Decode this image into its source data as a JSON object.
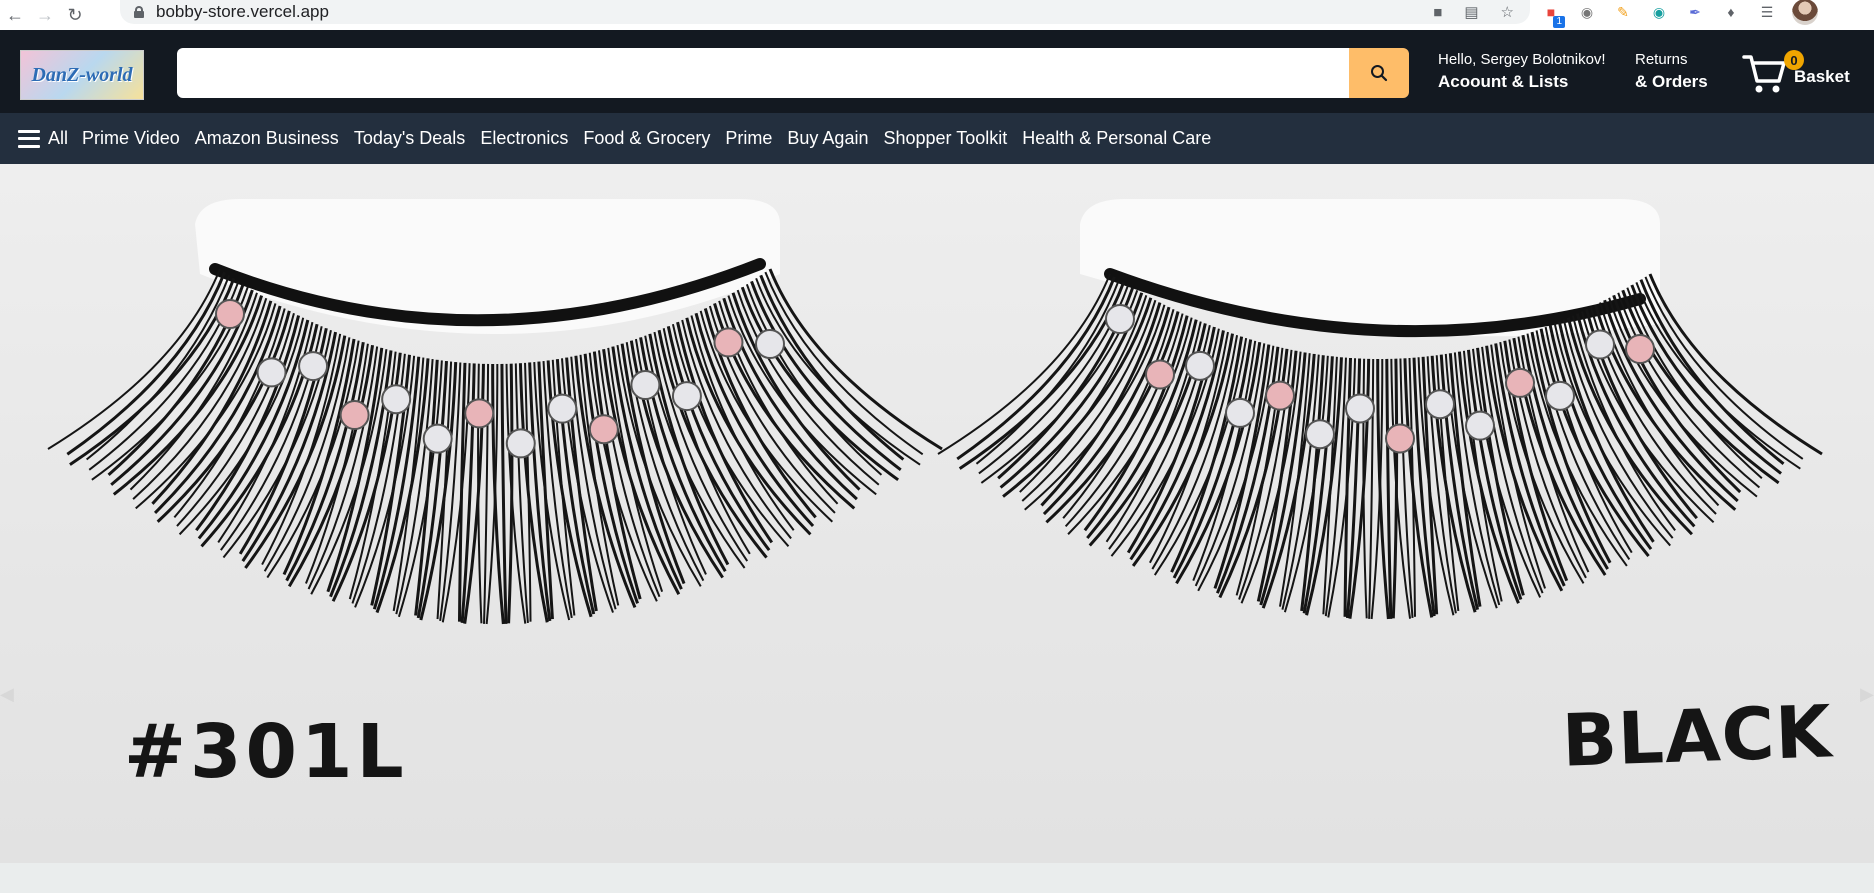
{
  "browser": {
    "url": "bobby-store.vercel.app",
    "extension_badge": "1"
  },
  "header": {
    "logo_text": "DanZ-world",
    "search": {
      "value": "",
      "placeholder": ""
    },
    "greeting": "Hello, Sergey Bolotnikov!",
    "account_label": "Acoount & Lists",
    "returns_label": "Returns",
    "orders_label": "& Orders",
    "basket_count": "0",
    "basket_label": "Basket"
  },
  "nav": {
    "all_label": "All",
    "items": [
      {
        "label": "Prime Video"
      },
      {
        "label": "Amazon Business"
      },
      {
        "label": "Today's Deals"
      },
      {
        "label": "Electronics"
      },
      {
        "label": "Food & Grocery"
      },
      {
        "label": "Prime"
      },
      {
        "label": "Buy Again"
      },
      {
        "label": "Shopper Toolkit"
      },
      {
        "label": "Health & Personal Care"
      }
    ]
  },
  "hero": {
    "product_code": "#301L",
    "product_color": "BLACK"
  },
  "colors": {
    "header_bg": "#131921",
    "nav_bg": "#232f3e",
    "search_button": "#febd69",
    "basket_badge": "#f0a500"
  }
}
